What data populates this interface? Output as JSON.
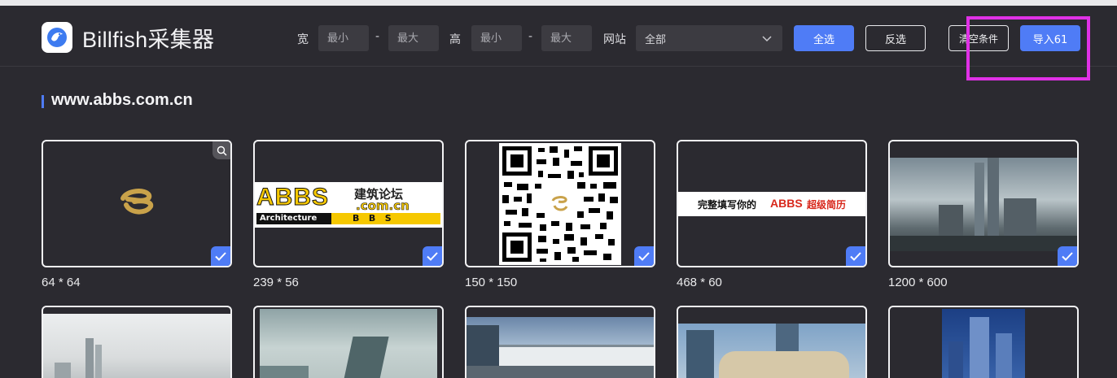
{
  "app": {
    "title": "Billfish采集器"
  },
  "filters": {
    "width_label": "宽",
    "height_label": "高",
    "site_label": "网站",
    "min_placeholder": "最小",
    "max_placeholder": "最大",
    "dash": "-",
    "site_value": "全部"
  },
  "actions": {
    "select_all": "全选",
    "invert": "反选",
    "clear": "清空条件",
    "import": "导入61"
  },
  "section": {
    "title": "www.abbs.com.cn"
  },
  "thumbnails": [
    {
      "dim": "64 * 64",
      "checked": true
    },
    {
      "dim": "239 * 56",
      "checked": true,
      "text_main": "ABBS",
      "text_sub": ".com.cn",
      "text_chinese": "建筑论坛",
      "text_bar": "Architecture",
      "text_bar_letters": "B   B   S"
    },
    {
      "dim": "150 * 150",
      "checked": true
    },
    {
      "dim": "468 * 60",
      "checked": true,
      "text_left": "完整填写你的",
      "text_brand": "ABBS",
      "text_right": "超级简历"
    },
    {
      "dim": "1200 * 600",
      "checked": true
    }
  ],
  "colors": {
    "accent": "#4f7cf6",
    "background": "#2b2a30",
    "highlight": "#e031e6"
  }
}
